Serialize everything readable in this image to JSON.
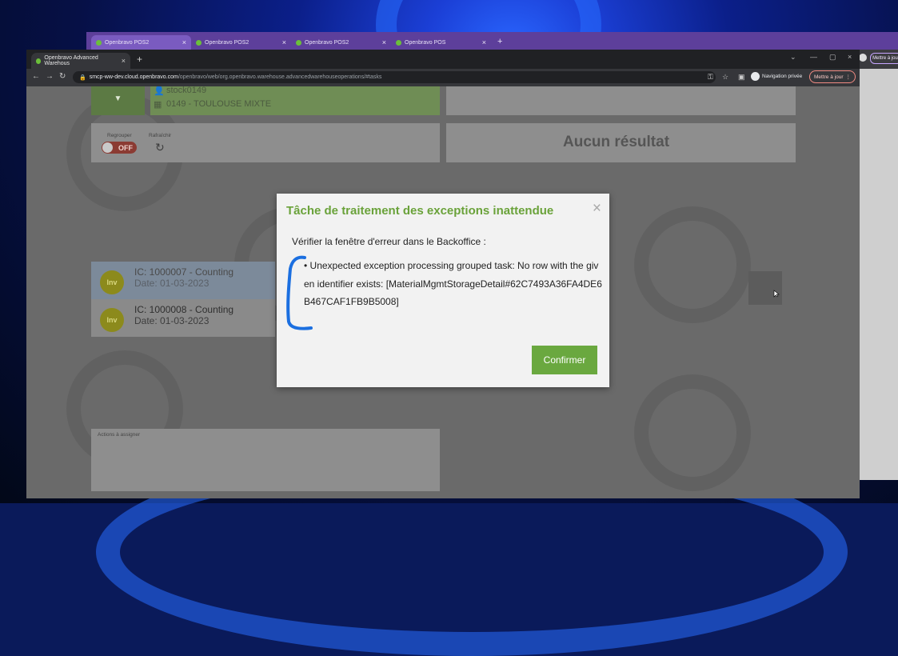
{
  "colors": {
    "accent_green": "#6aa23a",
    "confirm_green": "#6aa83f",
    "annotation_blue": "#1b6fe0",
    "back_window_purple": "#5d3f9b"
  },
  "back_window": {
    "tabs": [
      {
        "label": "Openbravo POS2"
      },
      {
        "label": "Openbravo POS2"
      },
      {
        "label": "Openbravo POS2"
      },
      {
        "label": "Openbravo POS"
      }
    ],
    "update_button": "Mettre à jour"
  },
  "front_window": {
    "tab_title": "Openbravo Advanced Warehous",
    "url_host": "smcp-ww-dev.cloud.openbravo.com",
    "url_path": "/openbravo/web/org.openbravo.warehouse.advancedwarehouseoperations/#tasks",
    "private_label": "Navigation privée",
    "update_button": "Mettre à jour"
  },
  "app": {
    "user": "stock0149",
    "warehouse": "0149 - TOULOUSE MIXTE",
    "regroup_label": "Regrouper",
    "toggle_state": "OFF",
    "refresh_label": "Rafraîchir",
    "no_result": "Aucun résultat",
    "tasks": [
      {
        "badge": "Inv",
        "title": "IC: 1000007 - Counting",
        "date": "Date: 01-03-2023"
      },
      {
        "badge": "Inv",
        "title": "IC: 1000008 - Counting",
        "date": "Date: 01-03-2023"
      }
    ],
    "actions_label": "Actions à assigner"
  },
  "dialog": {
    "title": "Tâche de traitement des exceptions inattendue",
    "close_symbol": "×",
    "subtitle": "Vérifier la fenêtre d'erreur dans le Backoffice :",
    "message": "• Unexpected exception processing grouped task: No row with the given identifier exists: [MaterialMgmtStorageDetail#62C7493A36FA4DE6B467CAF1FB9B5008]",
    "confirm": "Confirmer"
  }
}
